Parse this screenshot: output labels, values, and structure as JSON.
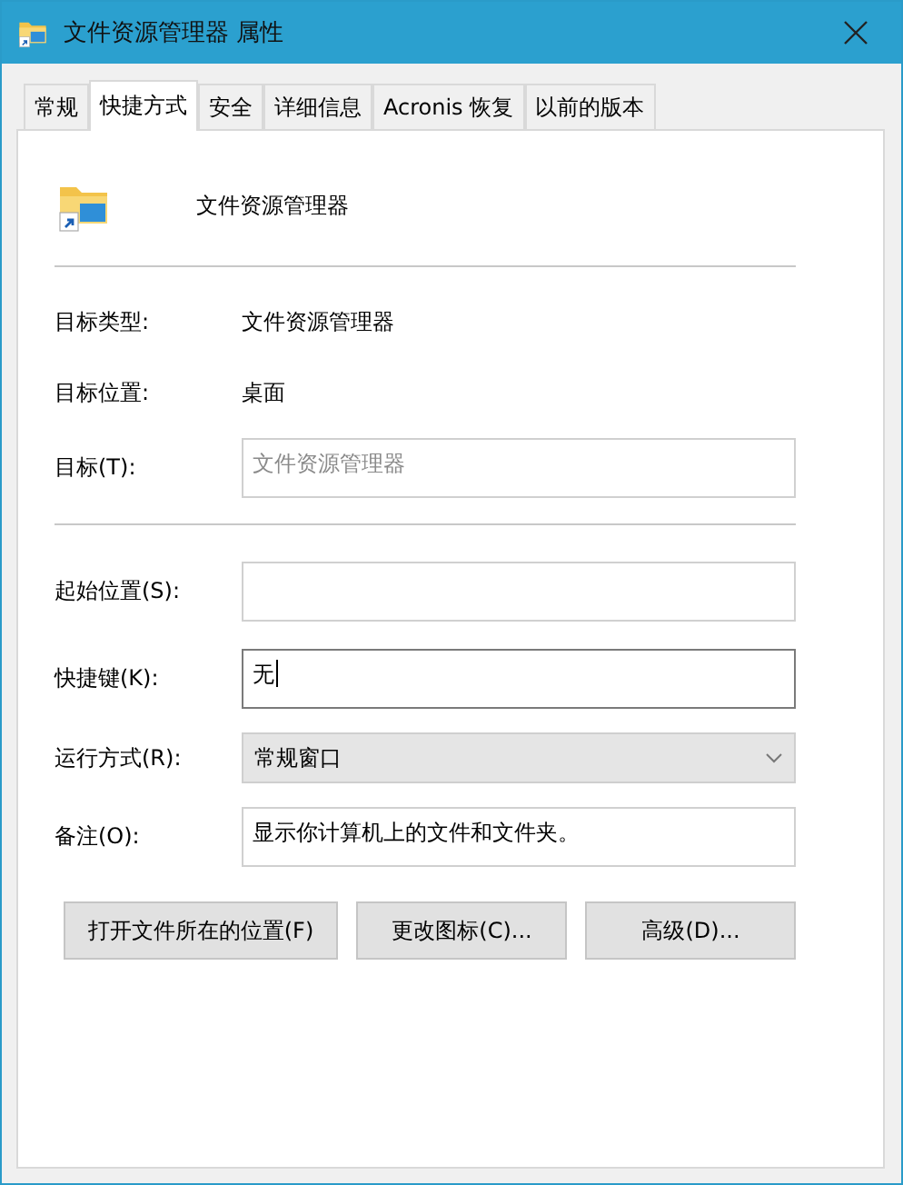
{
  "window": {
    "title": "文件资源管理器 属性"
  },
  "tabs": [
    {
      "label": "常规",
      "selected": false
    },
    {
      "label": "快捷方式",
      "selected": true
    },
    {
      "label": "安全",
      "selected": false
    },
    {
      "label": "详细信息",
      "selected": false
    },
    {
      "label": "Acronis 恢复",
      "selected": false
    },
    {
      "label": "以前的版本",
      "selected": false
    }
  ],
  "header": {
    "name": "文件资源管理器"
  },
  "info": [
    {
      "label": "目标类型:",
      "value": "文件资源管理器"
    },
    {
      "label": "目标位置:",
      "value": "桌面"
    }
  ],
  "target": {
    "label": "目标(T):",
    "value": "文件资源管理器",
    "disabled": true
  },
  "fields": [
    {
      "kind": "text",
      "label": "起始位置(S):",
      "focused": false
    },
    {
      "kind": "text",
      "label": "快捷键(K):",
      "value": "无",
      "focused": true
    },
    {
      "kind": "select",
      "label": "运行方式(R):",
      "value": "常规窗口",
      "focused": false
    },
    {
      "kind": "text",
      "label": "备注(O):",
      "value": "显示你计算机上的文件和文件夹。",
      "focused": false
    }
  ],
  "buttons": [
    "打开文件所在的位置(F)",
    "更改图标(C)...",
    "高级(D)..."
  ]
}
